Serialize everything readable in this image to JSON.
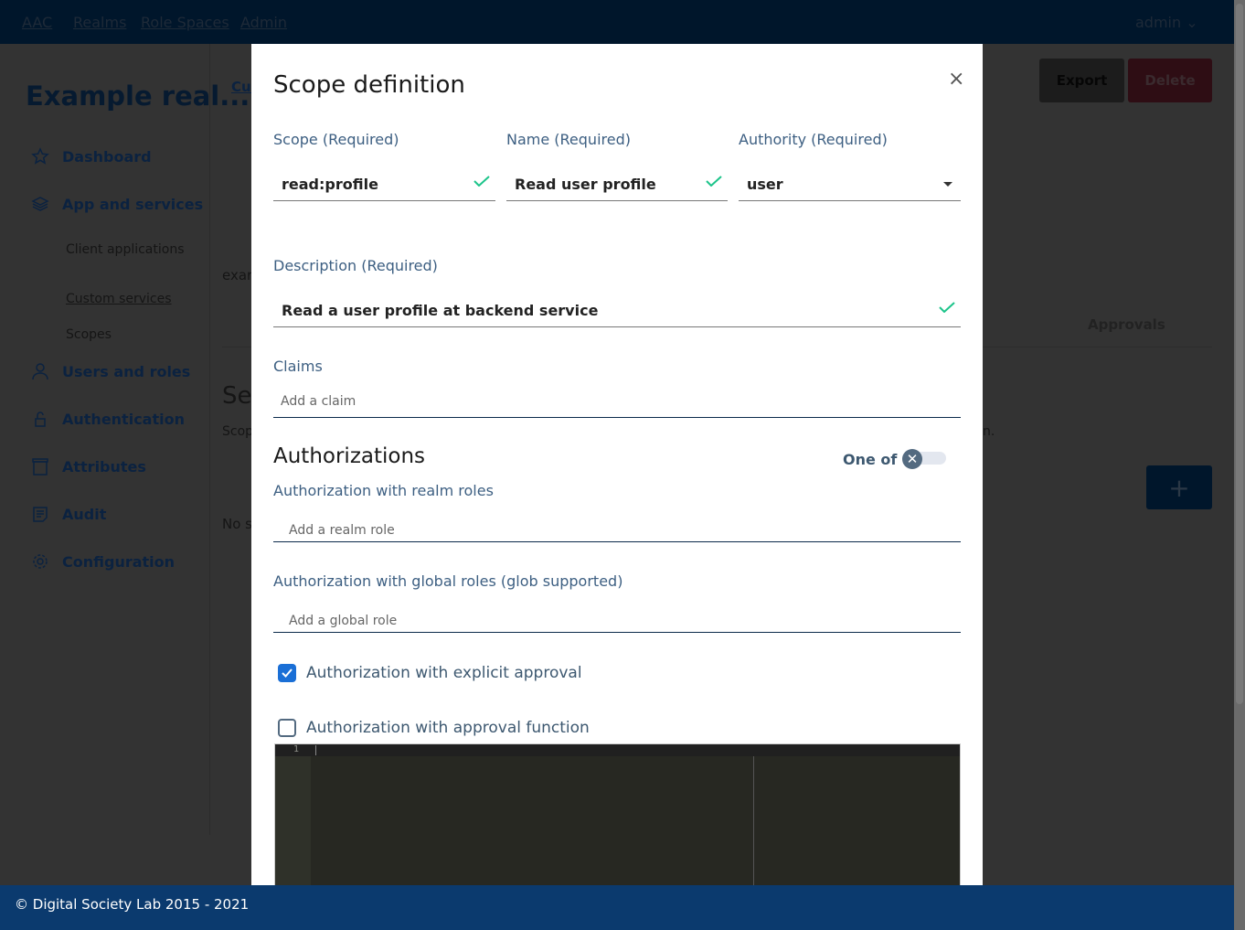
{
  "topbar": {
    "brand": "AAC",
    "links": [
      "Realms",
      "Role Spaces",
      "Admin"
    ],
    "user": "admin"
  },
  "sidebar": {
    "realm_title": "Example real...",
    "items": [
      {
        "label": "Dashboard",
        "icon": "star-icon"
      },
      {
        "label": "App and services",
        "icon": "layers-icon"
      },
      {
        "label": "Users and roles",
        "icon": "user-icon"
      },
      {
        "label": "Authentication",
        "icon": "lock-icon"
      },
      {
        "label": "Attributes",
        "icon": "archive-icon"
      },
      {
        "label": "Audit",
        "icon": "note-icon"
      },
      {
        "label": "Configuration",
        "icon": "gear-icon"
      }
    ],
    "subitems": [
      "Client applications",
      "Custom services",
      "Scopes"
    ]
  },
  "background": {
    "breadcrumb": "Cus",
    "example_text": "exar",
    "tab_approvals": "Approvals",
    "section_title": "Ser",
    "section_desc": "Scop",
    "desc_tail": "n.",
    "empty": "No s",
    "export": "Export",
    "delete": "Delete",
    "add": "+"
  },
  "modal": {
    "title": "Scope definition",
    "close": "×",
    "scope": {
      "label": "Scope (Required)",
      "value": "read:profile"
    },
    "name": {
      "label": "Name (Required)",
      "value": "Read user profile"
    },
    "authority": {
      "label": "Authority (Required)",
      "value": "user"
    },
    "description": {
      "label": "Description (Required)",
      "value": "Read a user profile at backend service"
    },
    "claims": {
      "label": "Claims",
      "placeholder": "Add a claim"
    },
    "authorizations": {
      "title": "Authorizations",
      "one_of": "One of",
      "one_of_enabled": false,
      "realm_roles": {
        "label": "Authorization with realm roles",
        "placeholder": "Add a realm role"
      },
      "global_roles": {
        "label": "Authorization with global roles (glob supported)",
        "placeholder": "Add a global role"
      },
      "explicit_approval": {
        "label": "Authorization with explicit approval",
        "checked": true
      },
      "approval_function": {
        "label": "Authorization with approval function",
        "checked": false
      }
    },
    "editor": {
      "line_number": "1"
    }
  },
  "footer": {
    "text": "© Digital Society Lab 2015 - 2021"
  },
  "colors": {
    "valid": "#1cc48a",
    "checkbox": "#1a6fd6",
    "footer": "#0b3a6e"
  }
}
